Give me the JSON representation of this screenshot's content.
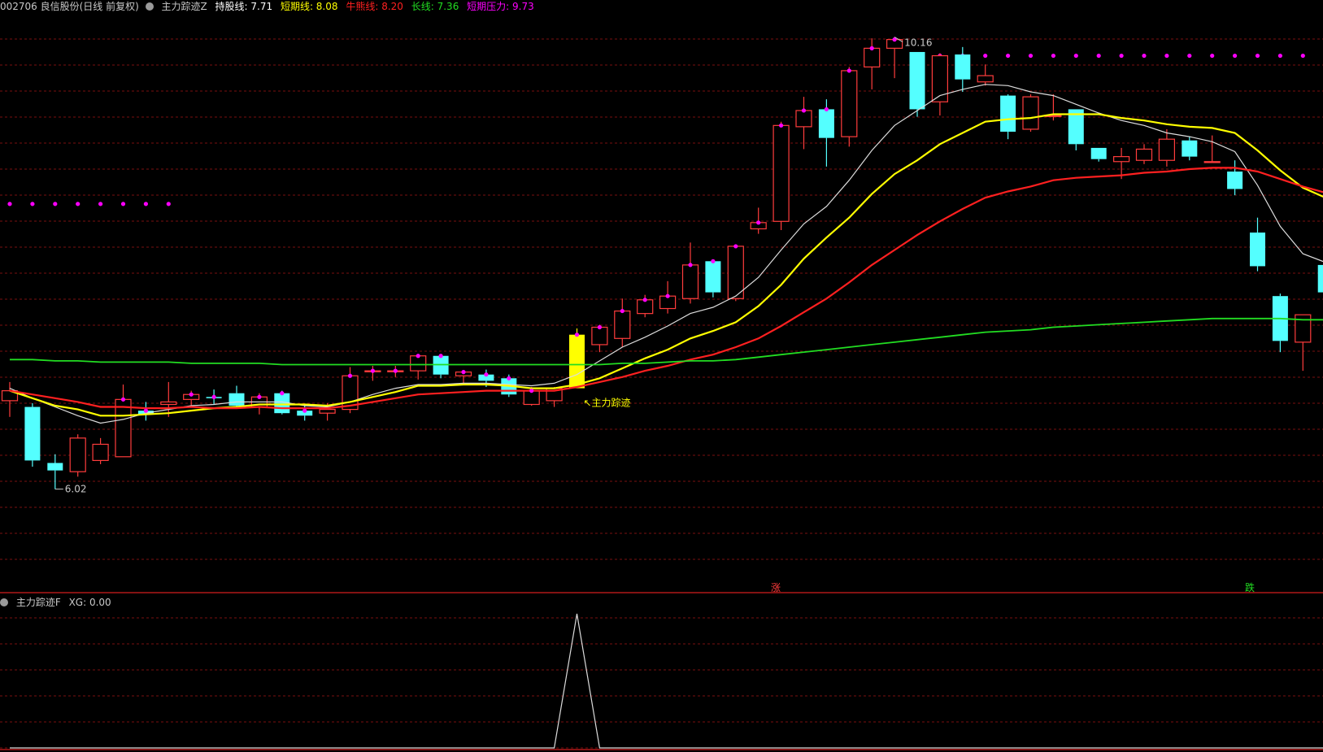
{
  "header": {
    "stock": "002706 良信股份(日线 前复权)",
    "indicator_name": "主力踪迹Z",
    "hold_label": "持股线: 7.71",
    "short_label": "短期线: 8.08",
    "bull_label": "牛熊线: 8.20",
    "long_label": "长线: 7.36",
    "pressure_label": "短期压力: 9.73"
  },
  "sub_header": {
    "indicator_name": "主力踪迹F",
    "xg_label": "XG: 0.00"
  },
  "colors": {
    "background": "#000000",
    "grid": "#7a1010",
    "up_candle": "#ff3c3c",
    "down_candle": "#54ffff",
    "hold_line": "#dcdcdc",
    "short_line": "#ffff00",
    "bull_line": "#ff2020",
    "long_line": "#22dd22",
    "pressure_dots": "#ff00ff",
    "signal_candle": "#ffff00",
    "sub_line": "#dcdcdc"
  },
  "chart_data": {
    "type": "candlestick",
    "annotations": {
      "high": "10.16",
      "low": "6.02",
      "signal": "主力踪迹",
      "rise_mark": "涨",
      "fall_mark": "跌"
    },
    "candles": [
      {
        "o": 7.25,
        "h": 7.4,
        "l": 7.12,
        "c": 7.33
      },
      {
        "o": 7.2,
        "h": 7.23,
        "l": 6.72,
        "c": 6.77
      },
      {
        "o": 6.75,
        "h": 6.82,
        "l": 6.54,
        "c": 6.69
      },
      {
        "o": 6.68,
        "h": 6.98,
        "l": 6.64,
        "c": 6.95
      },
      {
        "o": 6.77,
        "h": 6.95,
        "l": 6.74,
        "c": 6.9
      },
      {
        "o": 6.8,
        "h": 7.38,
        "l": 6.8,
        "c": 7.26
      },
      {
        "o": 7.17,
        "h": 7.24,
        "l": 7.09,
        "c": 7.14
      },
      {
        "o": 7.22,
        "h": 7.4,
        "l": 7.12,
        "c": 7.24
      },
      {
        "o": 7.26,
        "h": 7.33,
        "l": 7.21,
        "c": 7.3
      },
      {
        "o": 7.28,
        "h": 7.34,
        "l": 7.22,
        "c": 7.27
      },
      {
        "o": 7.31,
        "h": 7.37,
        "l": 7.19,
        "c": 7.21
      },
      {
        "o": 7.2,
        "h": 7.31,
        "l": 7.14,
        "c": 7.28
      },
      {
        "o": 7.31,
        "h": 7.33,
        "l": 7.14,
        "c": 7.15
      },
      {
        "o": 7.17,
        "h": 7.21,
        "l": 7.09,
        "c": 7.13
      },
      {
        "o": 7.15,
        "h": 7.23,
        "l": 7.09,
        "c": 7.18
      },
      {
        "o": 7.18,
        "h": 7.52,
        "l": 7.15,
        "c": 7.45
      },
      {
        "o": 7.49,
        "h": 7.53,
        "l": 7.41,
        "c": 7.49
      },
      {
        "o": 7.49,
        "h": 7.53,
        "l": 7.44,
        "c": 7.49
      },
      {
        "o": 7.49,
        "h": 7.61,
        "l": 7.42,
        "c": 7.61
      },
      {
        "o": 7.61,
        "h": 7.62,
        "l": 7.43,
        "c": 7.46
      },
      {
        "o": 7.45,
        "h": 7.48,
        "l": 7.38,
        "c": 7.48
      },
      {
        "o": 7.46,
        "h": 7.5,
        "l": 7.36,
        "c": 7.41
      },
      {
        "o": 7.43,
        "h": 7.46,
        "l": 7.28,
        "c": 7.3
      },
      {
        "o": 7.22,
        "h": 7.36,
        "l": 7.21,
        "c": 7.33
      },
      {
        "o": 7.25,
        "h": 7.36,
        "l": 7.2,
        "c": 7.35
      },
      {
        "o": 7.35,
        "h": 7.83,
        "l": 7.35,
        "c": 7.78,
        "signal": true
      },
      {
        "o": 7.7,
        "h": 7.86,
        "l": 7.64,
        "c": 7.84
      },
      {
        "o": 7.75,
        "h": 8.07,
        "l": 7.68,
        "c": 7.97
      },
      {
        "o": 7.95,
        "h": 8.1,
        "l": 7.92,
        "c": 8.06
      },
      {
        "o": 7.99,
        "h": 8.21,
        "l": 7.95,
        "c": 8.09
      },
      {
        "o": 8.07,
        "h": 8.52,
        "l": 8.03,
        "c": 8.34
      },
      {
        "o": 8.37,
        "h": 8.38,
        "l": 8.08,
        "c": 8.12
      },
      {
        "o": 8.07,
        "h": 8.48,
        "l": 8.05,
        "c": 8.49
      },
      {
        "o": 8.63,
        "h": 8.8,
        "l": 8.59,
        "c": 8.68
      },
      {
        "o": 8.69,
        "h": 9.49,
        "l": 8.62,
        "c": 9.46
      },
      {
        "o": 9.45,
        "h": 9.69,
        "l": 9.27,
        "c": 9.58
      },
      {
        "o": 9.59,
        "h": 9.67,
        "l": 9.13,
        "c": 9.36
      },
      {
        "o": 9.37,
        "h": 9.93,
        "l": 9.29,
        "c": 9.9
      },
      {
        "o": 9.93,
        "h": 10.16,
        "l": 9.75,
        "c": 10.08
      },
      {
        "o": 10.08,
        "h": 10.17,
        "l": 9.84,
        "c": 10.15
      },
      {
        "o": 10.05,
        "h": 10.05,
        "l": 9.53,
        "c": 9.59
      },
      {
        "o": 9.65,
        "h": 10.04,
        "l": 9.54,
        "c": 10.02
      },
      {
        "o": 10.03,
        "h": 10.09,
        "l": 9.73,
        "c": 9.83
      },
      {
        "o": 9.81,
        "h": 9.95,
        "l": 9.78,
        "c": 9.86
      },
      {
        "o": 9.7,
        "h": 9.71,
        "l": 9.35,
        "c": 9.41
      },
      {
        "o": 9.43,
        "h": 9.71,
        "l": 9.41,
        "c": 9.69
      },
      {
        "o": 9.54,
        "h": 9.71,
        "l": 9.5,
        "c": 9.54
      },
      {
        "o": 9.59,
        "h": 9.59,
        "l": 9.26,
        "c": 9.31
      },
      {
        "o": 9.28,
        "h": 9.28,
        "l": 9.17,
        "c": 9.19
      },
      {
        "o": 9.17,
        "h": 9.28,
        "l": 9.03,
        "c": 9.21
      },
      {
        "o": 9.18,
        "h": 9.31,
        "l": 9.15,
        "c": 9.27
      },
      {
        "o": 9.18,
        "h": 9.43,
        "l": 9.13,
        "c": 9.35
      },
      {
        "o": 9.34,
        "h": 9.37,
        "l": 9.18,
        "c": 9.21
      },
      {
        "o": 9.17,
        "h": 9.38,
        "l": 9.16,
        "c": 9.17
      },
      {
        "o": 9.09,
        "h": 9.18,
        "l": 8.9,
        "c": 8.95
      },
      {
        "o": 8.6,
        "h": 8.72,
        "l": 8.29,
        "c": 8.33
      },
      {
        "o": 8.09,
        "h": 8.11,
        "l": 7.64,
        "c": 7.73
      },
      {
        "o": 7.72,
        "h": 7.9,
        "l": 7.49,
        "c": 7.94
      },
      {
        "o": 8.34,
        "h": 8.41,
        "l": 8.01,
        "c": 8.12
      }
    ],
    "series": [
      {
        "name": "持股线",
        "values": [
          7.35,
          7.27,
          7.2,
          7.13,
          7.07,
          7.1,
          7.15,
          7.18,
          7.21,
          7.22,
          7.24,
          7.24,
          7.24,
          7.21,
          7.2,
          7.24,
          7.3,
          7.35,
          7.38,
          7.38,
          7.39,
          7.39,
          7.38,
          7.37,
          7.39,
          7.46,
          7.57,
          7.68,
          7.76,
          7.85,
          7.95,
          8.0,
          8.09,
          8.24,
          8.46,
          8.67,
          8.81,
          9.02,
          9.26,
          9.46,
          9.58,
          9.7,
          9.75,
          9.79,
          9.78,
          9.73,
          9.7,
          9.63,
          9.56,
          9.5,
          9.46,
          9.4,
          9.37,
          9.33,
          9.25,
          8.98,
          8.65,
          8.43,
          8.36
        ]
      },
      {
        "name": "短期线",
        "values": [
          7.33,
          7.27,
          7.21,
          7.18,
          7.13,
          7.13,
          7.14,
          7.15,
          7.17,
          7.19,
          7.2,
          7.22,
          7.22,
          7.22,
          7.21,
          7.24,
          7.28,
          7.32,
          7.37,
          7.37,
          7.38,
          7.38,
          7.37,
          7.35,
          7.35,
          7.38,
          7.43,
          7.51,
          7.59,
          7.66,
          7.75,
          7.81,
          7.88,
          8.01,
          8.18,
          8.39,
          8.56,
          8.72,
          8.91,
          9.07,
          9.18,
          9.31,
          9.4,
          9.49,
          9.51,
          9.52,
          9.55,
          9.55,
          9.55,
          9.52,
          9.5,
          9.47,
          9.45,
          9.44,
          9.4,
          9.26,
          9.1,
          8.96,
          8.88
        ]
      },
      {
        "name": "牛熊线",
        "values": [
          7.33,
          7.3,
          7.27,
          7.24,
          7.2,
          7.2,
          7.19,
          7.19,
          7.2,
          7.19,
          7.19,
          7.2,
          7.19,
          7.19,
          7.19,
          7.21,
          7.24,
          7.27,
          7.3,
          7.31,
          7.32,
          7.33,
          7.33,
          7.33,
          7.33,
          7.36,
          7.4,
          7.44,
          7.49,
          7.53,
          7.58,
          7.62,
          7.68,
          7.75,
          7.85,
          7.96,
          8.07,
          8.2,
          8.34,
          8.46,
          8.58,
          8.69,
          8.79,
          8.88,
          8.93,
          8.97,
          9.02,
          9.04,
          9.05,
          9.06,
          9.08,
          9.09,
          9.11,
          9.12,
          9.12,
          9.09,
          9.03,
          8.97,
          8.92
        ]
      },
      {
        "name": "长线",
        "values": [
          7.58,
          7.58,
          7.57,
          7.57,
          7.56,
          7.56,
          7.56,
          7.56,
          7.55,
          7.55,
          7.55,
          7.55,
          7.54,
          7.54,
          7.54,
          7.54,
          7.54,
          7.54,
          7.54,
          7.54,
          7.54,
          7.54,
          7.54,
          7.54,
          7.54,
          7.54,
          7.54,
          7.55,
          7.55,
          7.56,
          7.57,
          7.57,
          7.58,
          7.6,
          7.62,
          7.64,
          7.66,
          7.68,
          7.7,
          7.72,
          7.74,
          7.76,
          7.78,
          7.8,
          7.81,
          7.82,
          7.84,
          7.85,
          7.86,
          7.87,
          7.88,
          7.89,
          7.9,
          7.91,
          7.91,
          7.91,
          7.91,
          7.9,
          7.9
        ]
      }
    ],
    "pressure_segments": [
      {
        "from": 0,
        "to": 7,
        "value": 8.83
      },
      {
        "from": 40,
        "to": 58,
        "value": 10.02
      }
    ],
    "pressure_dot_indices": [
      5,
      6,
      8,
      9,
      11,
      12,
      13,
      15,
      16,
      17,
      18,
      19,
      20,
      21,
      22,
      23,
      25,
      26,
      27,
      28,
      29,
      30,
      31,
      32,
      33,
      34,
      35,
      36,
      37,
      38,
      39
    ],
    "price_range": [
      5.8,
      10.35
    ],
    "sub_chart": {
      "type": "line",
      "values": [
        0,
        0,
        0,
        0,
        0,
        0,
        0,
        0,
        0,
        0,
        0,
        0,
        0,
        0,
        0,
        0,
        0,
        0,
        0,
        0,
        0,
        0,
        0,
        0,
        0,
        1,
        0,
        0,
        0,
        0,
        0,
        0,
        0,
        0,
        0,
        0,
        0,
        0,
        0,
        0,
        0,
        0,
        0,
        0,
        0,
        0,
        0,
        0,
        0,
        0,
        0,
        0,
        0,
        0,
        0,
        0,
        0,
        0,
        0
      ],
      "range": [
        0,
        1
      ]
    }
  }
}
